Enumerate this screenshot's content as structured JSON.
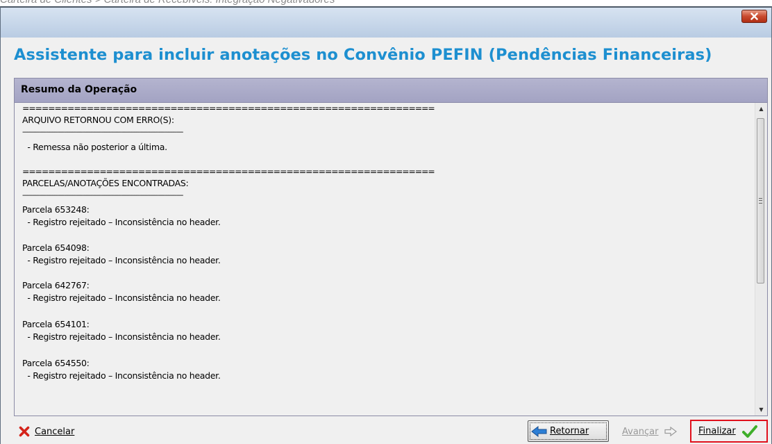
{
  "caption": "Carteira de Clientes > Carteira de Recebíveis: Integração Negativadores",
  "window": {
    "close_glyph": "✕"
  },
  "header": {
    "title": "Assistente para incluir anotações no Convênio PEFIN (Pendências Financeiras)"
  },
  "panel": {
    "title": "Resumo da Operação",
    "lines": [
      {
        "text": "================================================================",
        "kind": "eq"
      },
      {
        "text": "ARQUIVO RETORNOU COM ERRO(S):",
        "kind": "text"
      },
      {
        "text": "------------------------------------------------------------------------------------------------",
        "kind": "dash"
      },
      {
        "text": "  - Remessa não posterior a última.",
        "kind": "text"
      },
      {
        "text": "================================================================",
        "kind": "eq"
      },
      {
        "text": "PARCELAS/ANOTAÇÕES ENCONTRADAS:",
        "kind": "text"
      },
      {
        "text": "------------------------------------------------------------------------------------------------",
        "kind": "dash"
      },
      {
        "text": "Parcela 653248:",
        "kind": "text"
      },
      {
        "text": "  - Registro rejeitado – Inconsistência no header.",
        "kind": "text"
      },
      {
        "text": "Parcela 654098:",
        "kind": "text"
      },
      {
        "text": "  - Registro rejeitado – Inconsistência no header.",
        "kind": "text"
      },
      {
        "text": "Parcela 642767:",
        "kind": "text"
      },
      {
        "text": "  - Registro rejeitado – Inconsistência no header.",
        "kind": "text"
      },
      {
        "text": "Parcela 654101:",
        "kind": "text"
      },
      {
        "text": "  - Registro rejeitado – Inconsistência no header.",
        "kind": "text"
      },
      {
        "text": "Parcela 654550:",
        "kind": "text"
      },
      {
        "text": "  - Registro rejeitado – Inconsistência no header.",
        "kind": "text"
      }
    ]
  },
  "footer": {
    "cancel": {
      "label": "Cancelar",
      "icon": "red-x-icon"
    },
    "retornar": {
      "label": "Retornar",
      "icon": "blue-left-arrow-icon"
    },
    "avancar": {
      "label": "Avançar",
      "icon": "gray-right-arrow-icon",
      "disabled": true
    },
    "finalizar": {
      "label": "Finalizar",
      "icon": "green-check-icon"
    }
  },
  "colors": {
    "title": "#1d8fd0",
    "panel_header": "#a8a8c6",
    "highlight": "#e0101c"
  }
}
